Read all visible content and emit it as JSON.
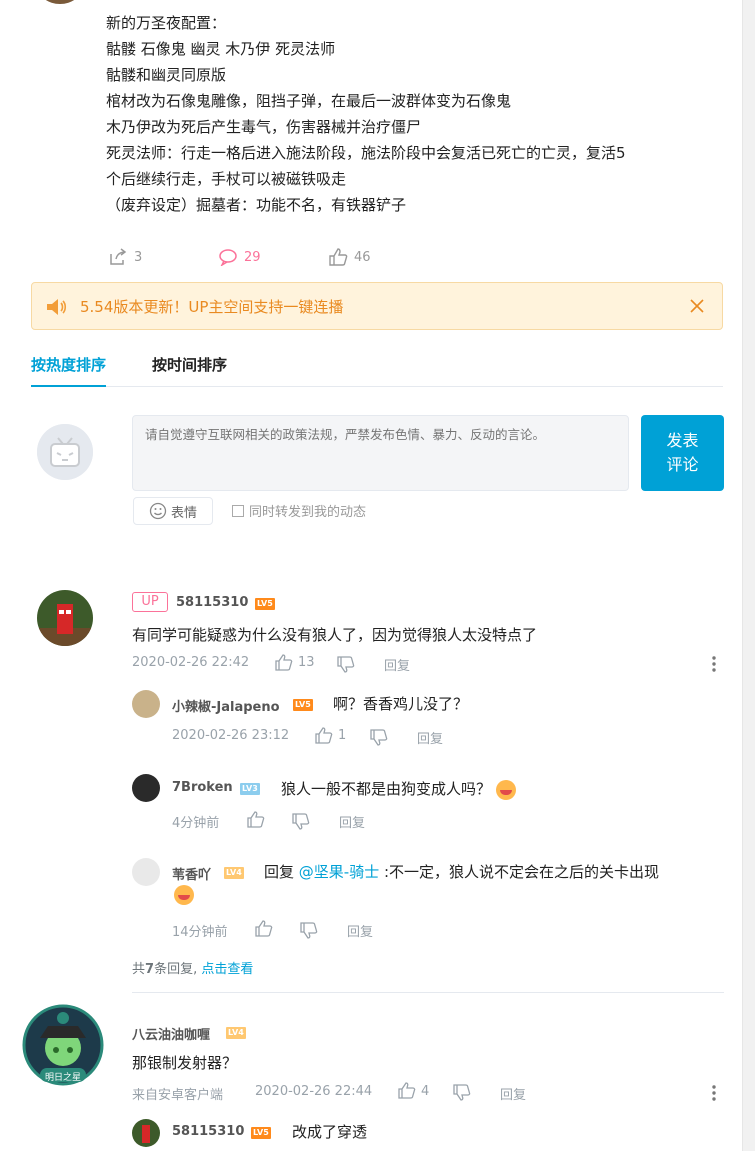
{
  "post": {
    "lines": [
      "新的万圣夜配置：",
      "骷髅 石像鬼 幽灵 木乃伊 死灵法师",
      "骷髅和幽灵同原版",
      "棺材改为石像鬼雕像，阻挡子弹，在最后一波群体变为石像鬼",
      "木乃伊改为死后产生毒气，伤害器械并治疗僵尸",
      "死灵法师：行走一格后进入施法阶段，施法阶段中会复活已死亡的亡灵，复活5",
      "个后继续行走，手杖可以被磁铁吸走",
      "（废弃设定）掘墓者：功能不名，有铁器铲子"
    ],
    "share_count": "3",
    "comment_count": "29",
    "like_count": "46"
  },
  "notice": {
    "text": "5.54版本更新！UP主空间支持一键连播"
  },
  "tabs": {
    "hot": "按热度排序",
    "time": "按时间排序"
  },
  "composer": {
    "placeholder": "请自觉遵守互联网相关的政策法规，严禁发布色情、暴力、反动的言论。",
    "send_line1": "发表",
    "send_line2": "评论",
    "emoji_label": "表情",
    "share_label": "同时转发到我的动态"
  },
  "comments": [
    {
      "up_badge": "UP",
      "user": "58115310",
      "level": "LV5",
      "text": "有同学可能疑惑为什么没有狼人了，因为觉得狼人太没特点了",
      "time": "2020-02-26 22:42",
      "likes": "13",
      "reply_label": "回复",
      "replies": [
        {
          "user": "小辣椒-Jalapeno",
          "level": "LV5",
          "text": "啊？香香鸡儿没了？",
          "time": "2020-02-26 23:12",
          "likes": "1",
          "reply_label": "回复"
        },
        {
          "user": "7Broken",
          "level": "LV3",
          "text": "狼人一般不都是由狗变成人吗？",
          "time": "4分钟前",
          "likes": "",
          "reply_label": "回复"
        },
        {
          "user": "苇香吖",
          "level": "LV4",
          "text_prefix": "回复",
          "mention": "@坚果-骑士",
          "text": ":不一定，狼人说不定会在之后的关卡出现",
          "time": "14分钟前",
          "likes": "",
          "reply_label": "回复"
        }
      ],
      "summary_prefix": "共",
      "summary_count": "7",
      "summary_suffix": "条回复,",
      "summary_link": "点击查看"
    },
    {
      "user": "八云油油咖喱",
      "level": "LV4",
      "text": "那银制发射器？",
      "source": "来自安卓客户端",
      "time": "2020-02-26 22:44",
      "likes": "4",
      "reply_label": "回复",
      "avatar_text": "明日之星",
      "replies": [
        {
          "user": "58115310",
          "level": "LV5",
          "text": "改成了穿透"
        }
      ]
    }
  ],
  "colors": {
    "accent": "#00a1d6",
    "pink": "#fb7299",
    "notice_text": "#e98a21"
  }
}
